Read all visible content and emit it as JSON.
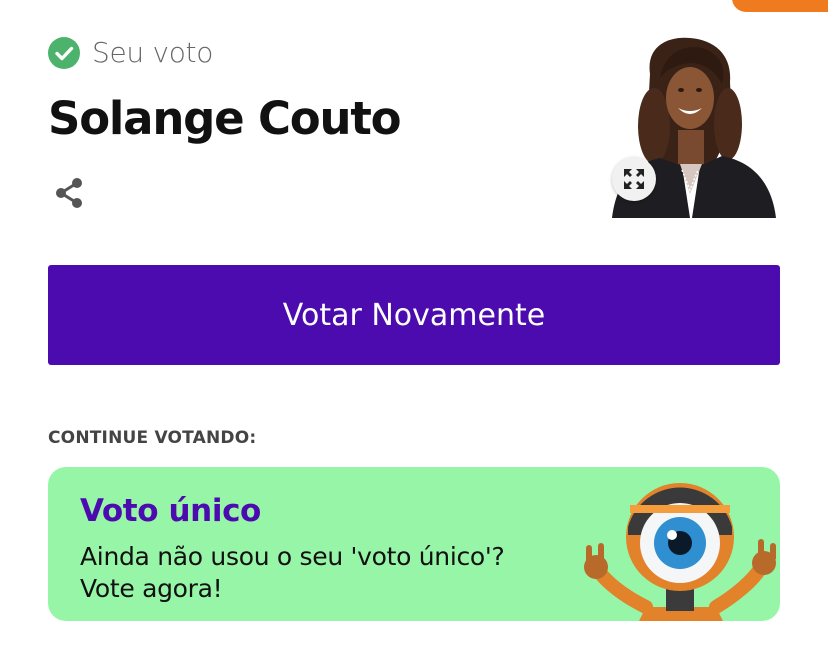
{
  "vote": {
    "label": "Seu voto",
    "candidate_name": "Solange Couto"
  },
  "icons": {
    "check": "check-circle-icon",
    "share": "share-icon",
    "expand": "expand-icon"
  },
  "actions": {
    "vote_again_label": "Votar Novamente"
  },
  "continue_section": {
    "label": "CONTINUE VOTANDO:",
    "card": {
      "title": "Voto único",
      "description": "Ainda não usou o seu 'voto único'? Vote agora!"
    }
  },
  "colors": {
    "primary": "#4b0bae",
    "check_green": "#4db36c",
    "card_bg": "#97f5a8",
    "top_accent": "#f07a1e"
  }
}
